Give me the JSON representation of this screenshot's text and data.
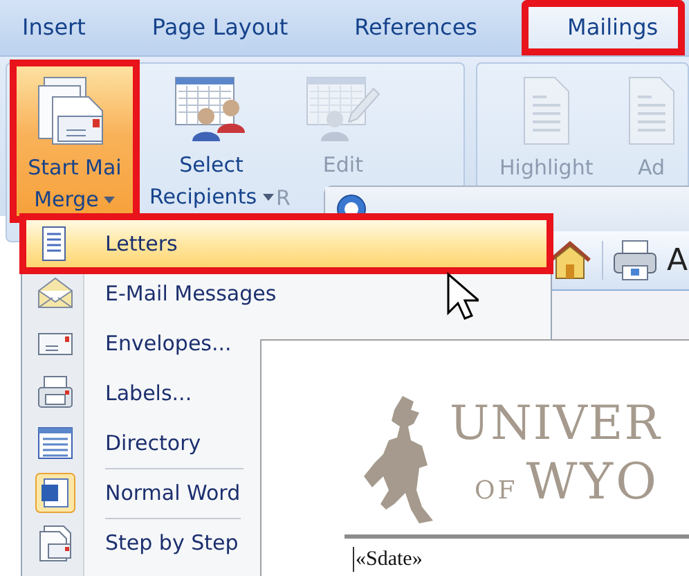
{
  "tabs": [
    {
      "label": "Insert",
      "selected": false,
      "highlighted": false
    },
    {
      "label": "Page Layout",
      "selected": false,
      "highlighted": false
    },
    {
      "label": "References",
      "selected": false,
      "highlighted": false
    },
    {
      "label": "Mailings",
      "selected": true,
      "highlighted": true
    }
  ],
  "ribbon": {
    "groups": [
      {
        "buttons": [
          {
            "kind": "large",
            "lines": [
              "Start Mai",
              "Merge"
            ],
            "dropdown": true,
            "highlighted": true,
            "disabled": false
          },
          {
            "kind": "large",
            "lines": [
              "Select",
              "Recipients"
            ],
            "dropdown": true,
            "highlighted": false,
            "disabled": false
          },
          {
            "kind": "partial",
            "lines": [
              "R"
            ]
          },
          {
            "kind": "large",
            "lines": [
              "Edit"
            ],
            "dropdown": false,
            "highlighted": false,
            "disabled": true
          }
        ]
      },
      {
        "buttons": [
          {
            "kind": "large",
            "lines": [
              "Highlight"
            ],
            "dropdown": false,
            "highlighted": false,
            "disabled": true
          },
          {
            "kind": "large",
            "lines": [
              "Ad"
            ],
            "dropdown": false,
            "highlighted": false,
            "disabled": true
          }
        ]
      }
    ]
  },
  "help_window": {
    "toolbar_text": "A"
  },
  "menu": {
    "items": [
      {
        "label": "Letters",
        "selected": true,
        "highlighted": true,
        "separator_before": false
      },
      {
        "label": "E-Mail Messages",
        "selected": false,
        "highlighted": false,
        "separator_before": false
      },
      {
        "label": "Envelopes...",
        "selected": false,
        "highlighted": false,
        "separator_before": false
      },
      {
        "label": "Labels...",
        "selected": false,
        "highlighted": false,
        "separator_before": false
      },
      {
        "label": "Directory",
        "selected": false,
        "highlighted": false,
        "separator_before": false
      },
      {
        "label": "Normal Word",
        "selected": false,
        "highlighted": false,
        "separator_before": true
      },
      {
        "label": "Step by Step",
        "selected": false,
        "highlighted": false,
        "separator_before": true
      }
    ]
  },
  "document": {
    "logo_line_1": "UNIVER",
    "logo_line_2_small": "OF",
    "logo_line_2": "WYO",
    "field": "«Sdate»"
  }
}
